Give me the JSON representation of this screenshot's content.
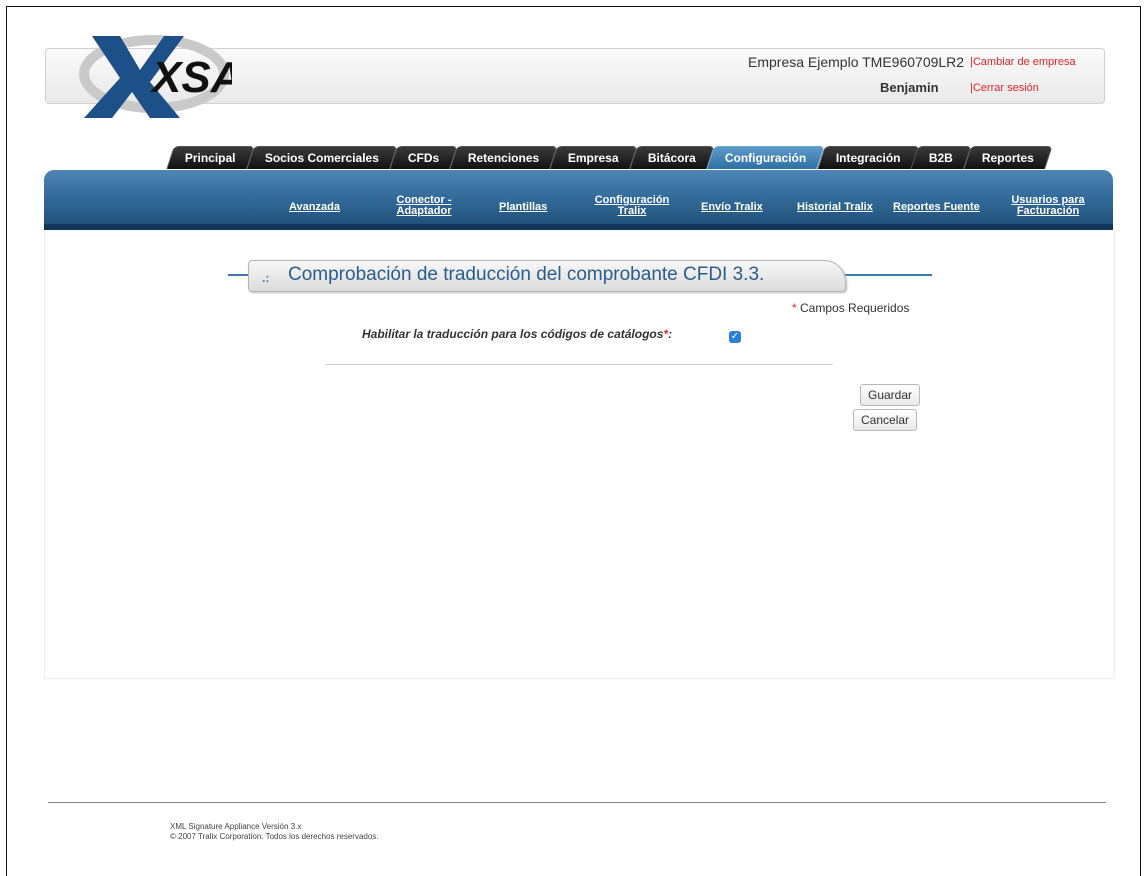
{
  "header": {
    "logo_text": "XSA",
    "company": "Empresa Ejemplo TME960709LR2",
    "change_company": "Cambiar de empresa",
    "user": "Benjamin",
    "logout": "Cerrar sesión",
    "separator": "|"
  },
  "tabs": [
    {
      "label": "Principal"
    },
    {
      "label": "Socios Comerciales"
    },
    {
      "label": "CFDs"
    },
    {
      "label": "Retenciones"
    },
    {
      "label": "Empresa"
    },
    {
      "label": "Bitácora"
    },
    {
      "label": "Configuración"
    },
    {
      "label": "Integración"
    },
    {
      "label": "B2B"
    },
    {
      "label": "Reportes"
    }
  ],
  "subnav": {
    "avanzada": "Avanzada",
    "conector": "Conector - Adaptador",
    "plantillas": "Plantillas",
    "config_tralix": "Configuración Tralix",
    "envio_tralix": "Envío Tralix",
    "historial": "Historial Tralix",
    "reportes_fuente": "Reportes Fuente",
    "usuarios": "Usuarios para Facturación"
  },
  "main": {
    "title": "Comprobación de traducción del comprobante CFDI 3.3.",
    "required_star": "*",
    "required_note": "Campos Requeridos",
    "field_label": "Habilitar la traducción para los códigos de catálogos",
    "field_star": "*",
    "field_colon": ":",
    "checkbox_checked": true,
    "save": "Guardar",
    "cancel": "Cancelar"
  },
  "footer": {
    "line1": "XML Signature Appliance Versión 3.x",
    "line2": "© 2007 Tralix Corporation. Todos los derechos reservados."
  },
  "colors": {
    "accent": "#2f6fa3",
    "link_red": "#e0252a"
  }
}
